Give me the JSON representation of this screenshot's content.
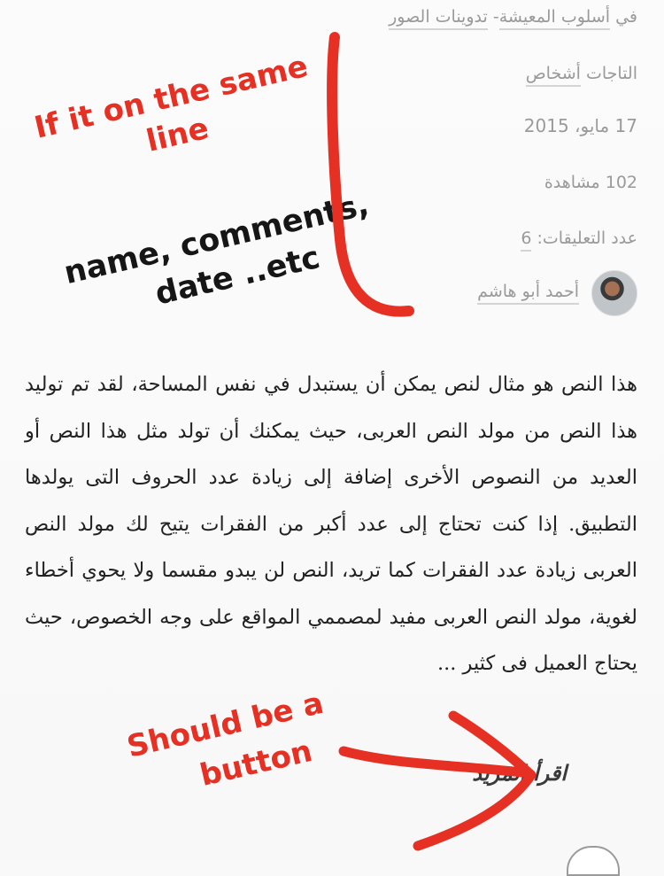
{
  "meta": {
    "category_prefix": "في",
    "category_1": "أسلوب المعيشة",
    "category_sep": "-",
    "category_2": "تدوينات الصور",
    "tags_label": "التاجات",
    "tag_1": "أشخاص",
    "date": "17 مايو، 2015",
    "views": "102 مشاهدة",
    "comments_label": "عدد التعليقات:",
    "comments_count": "6",
    "author_name": "أحمد أبو هاشم"
  },
  "article": {
    "text": "هذا النص هو مثال لنص يمكن أن يستبدل في نفس المساحة، لقد تم توليد هذا النص من مولد النص العربى، حيث يمكنك أن تولد مثل هذا النص أو العديد من النصوص الأخرى إضافة إلى زيادة عدد الحروف التى يولدها التطبيق. إذا كنت تحتاج إلى عدد أكبر من الفقرات يتيح لك مولد النص العربى زيادة عدد الفقرات كما تريد، النص لن يبدو مقسما ولا يحوي أخطاء لغوية، مولد النص العربى مفيد لمصممي المواقع على وجه الخصوص، حيث يحتاج العميل فى كثير ...",
    "read_more": "اقرأ المزيد"
  },
  "annotations": {
    "note_1_line_1": "If it on the same",
    "note_1_line_2": "line",
    "note_2_line_1": "name, comments,",
    "note_2_line_2": "date ..etc",
    "note_3_line_1": "Should be a",
    "note_3_line_2": "button",
    "red": "#e53023",
    "black": "#161616"
  }
}
